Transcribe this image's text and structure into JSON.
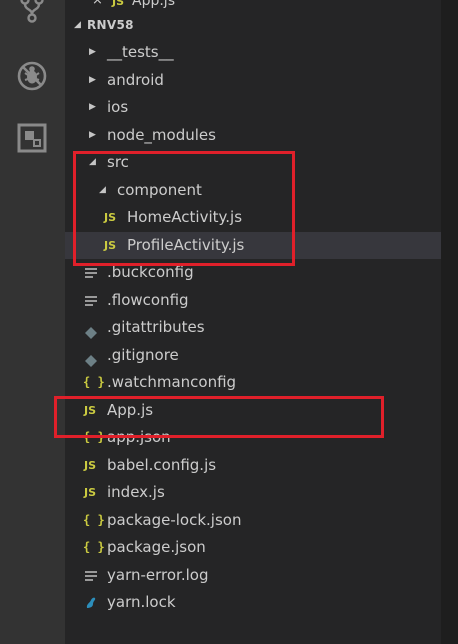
{
  "activity_bar": {
    "icons": [
      "source-control-icon",
      "debug-icon",
      "extensions-icon"
    ]
  },
  "open_editor_partial": {
    "name": "App.js",
    "close_glyph": "×"
  },
  "explorer": {
    "section_title": "RNV58",
    "items": [
      {
        "label": "__tests__",
        "kind": "folder",
        "expanded": false
      },
      {
        "label": "android",
        "kind": "folder",
        "expanded": false
      },
      {
        "label": "ios",
        "kind": "folder",
        "expanded": false
      },
      {
        "label": "node_modules",
        "kind": "folder",
        "expanded": false
      },
      {
        "label": "src",
        "kind": "folder",
        "expanded": true
      },
      {
        "label": "component",
        "kind": "folder",
        "expanded": true
      },
      {
        "label": "HomeActivity.js",
        "kind": "js"
      },
      {
        "label": "ProfileActivity.js",
        "kind": "js",
        "selected": true
      },
      {
        "label": ".buckconfig",
        "kind": "text"
      },
      {
        "label": ".flowconfig",
        "kind": "text"
      },
      {
        "label": ".gitattributes",
        "kind": "git"
      },
      {
        "label": ".gitignore",
        "kind": "git"
      },
      {
        "label": ".watchmanconfig",
        "kind": "json"
      },
      {
        "label": "App.js",
        "kind": "js"
      },
      {
        "label": "app.json",
        "kind": "json"
      },
      {
        "label": "babel.config.js",
        "kind": "js"
      },
      {
        "label": "index.js",
        "kind": "js"
      },
      {
        "label": "package-lock.json",
        "kind": "json"
      },
      {
        "label": "package.json",
        "kind": "json"
      },
      {
        "label": "yarn-error.log",
        "kind": "text"
      },
      {
        "label": "yarn.lock",
        "kind": "yarn"
      }
    ]
  },
  "icons": {
    "js": "JS",
    "json": "{ }"
  },
  "colors": {
    "activity_bar": "#333333",
    "sidebar": "#252526",
    "selected_row": "#37373d",
    "js_icon": "#cbcb41",
    "git_icon": "#6d8086",
    "yarn_icon": "#2c8ebb",
    "highlight_box": "#e0202a"
  }
}
